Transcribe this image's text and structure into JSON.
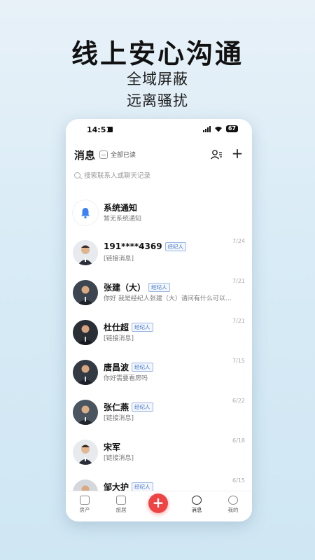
{
  "promo": {
    "headline": "线上安心沟通",
    "sub1": "全域屏蔽",
    "sub2": "远离骚扰"
  },
  "status_bar": {
    "time": "14:51",
    "battery": "67"
  },
  "header": {
    "title": "消息",
    "read_all": "全部已读"
  },
  "search": {
    "placeholder": "搜索联系人或聊天记录"
  },
  "conversations": [
    {
      "name": "系统通知",
      "tag": "",
      "message": "暂无系统通知",
      "date": ""
    },
    {
      "name": "191****4369",
      "tag": "经纪人",
      "message": "[链接消息]",
      "date": "7/24"
    },
    {
      "name": "张建（大）",
      "tag": "经纪人",
      "message": "你好 我是经纪人张建（大）请问有什么可以…",
      "date": "7/21"
    },
    {
      "name": "杜仕超",
      "tag": "经纪人",
      "message": "[链接消息]",
      "date": "7/21"
    },
    {
      "name": "唐昌波",
      "tag": "经纪人",
      "message": "你好需要看房吗",
      "date": "7/15"
    },
    {
      "name": "张仁燕",
      "tag": "经纪人",
      "message": "[链接消息]",
      "date": "6/22"
    },
    {
      "name": "宋军",
      "tag": "",
      "message": "[链接消息]",
      "date": "6/18"
    },
    {
      "name": "邹大护",
      "tag": "经纪人",
      "message": "",
      "date": "6/15"
    }
  ],
  "bottom_nav": {
    "home": "房产",
    "discover": "旅居",
    "messages": "消息",
    "me": "我的",
    "fab": "+"
  },
  "colors": {
    "accent": "#ef4444",
    "tag": "#4a78c8"
  }
}
